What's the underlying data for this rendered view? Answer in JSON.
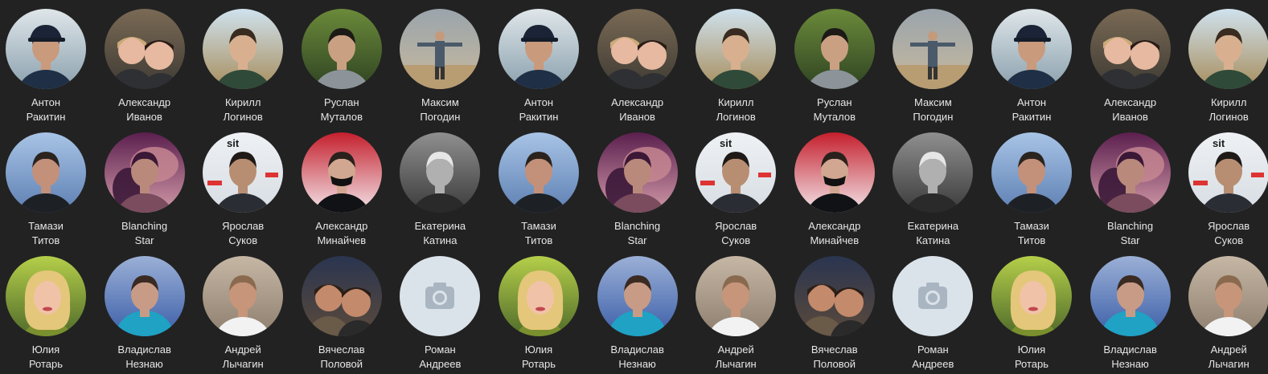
{
  "people": [
    {
      "first": "Антон",
      "last": "Ракитин",
      "photo": "man-cap-blue"
    },
    {
      "first": "Александр",
      "last": "Иванов",
      "photo": "couple-selfie"
    },
    {
      "first": "Кирилл",
      "last": "Логинов",
      "photo": "man-beach"
    },
    {
      "first": "Руслан",
      "last": "Муталов",
      "photo": "man-forest"
    },
    {
      "first": "Максим",
      "last": "Погодин",
      "photo": "man-arms-out"
    },
    {
      "first": "Тамази",
      "last": "Титов",
      "photo": "man-sky"
    },
    {
      "first": "Blanching",
      "last": "Star",
      "photo": "abstract-purple"
    },
    {
      "first": "Ярослав",
      "last": "Суков",
      "photo": "man-suit-banner"
    },
    {
      "first": "Александр",
      "last": "Минайчев",
      "photo": "man-red-shop"
    },
    {
      "first": "Екатерина",
      "last": "Катина",
      "photo": "bw-portrait"
    },
    {
      "first": "Юлия",
      "last": "Ротарь",
      "photo": "woman-blonde-flowers"
    },
    {
      "first": "Владислав",
      "last": "Незнаю",
      "photo": "person-blue-shirt"
    },
    {
      "first": "Андрей",
      "last": "Лычагин",
      "photo": "man-white-shirt"
    },
    {
      "first": "Вячеслав",
      "last": "Половой",
      "photo": "couple-night"
    },
    {
      "first": "Роман",
      "last": "Андреев",
      "photo": "camera-placeholder"
    }
  ],
  "colors": {
    "background": "#222222",
    "text": "#e6e6e6",
    "placeholder_bg": "#dbe3ea",
    "placeholder_icon": "#a9b6c2"
  }
}
